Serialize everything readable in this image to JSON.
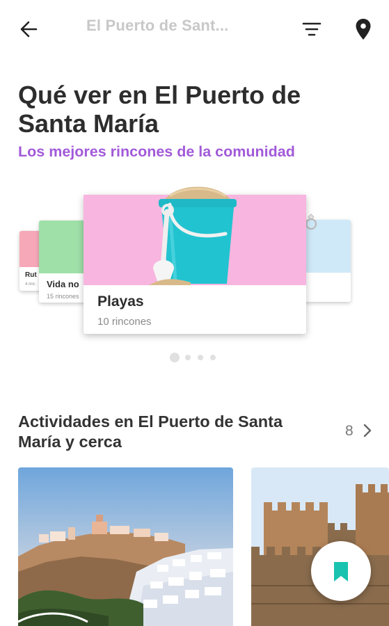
{
  "appbar": {
    "title": "El Puerto de Sant...",
    "icons": [
      "back-arrow-icon",
      "filter-icon",
      "location-pin-icon"
    ]
  },
  "header": {
    "title": "Qué ver en El Puerto de Santa María",
    "subtitle": "Los mejores rincones de la comunidad",
    "subtitle_color": "#a25ad9"
  },
  "carousel": {
    "cards": [
      {
        "name": "Rut",
        "count": "4 rinc",
        "color": "#f7a8b8"
      },
      {
        "name": "Vida no",
        "count": "15 rincones",
        "color": "#9fe0a9"
      },
      {
        "name": "Playas",
        "count": "10 rincones",
        "color": "#f7b5df"
      },
      {
        "name": "",
        "count": "",
        "color": "#cfe9f9"
      }
    ],
    "page_count": 4,
    "active_page": 1
  },
  "activities": {
    "title": "Actividades en El Puerto de Santa María y cerca",
    "count": "8"
  },
  "accent_color": "#19c3b0"
}
